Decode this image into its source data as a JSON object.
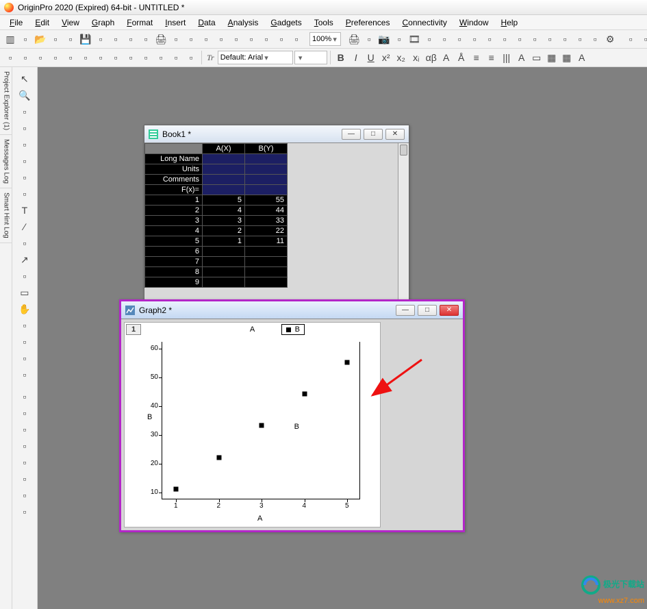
{
  "app": {
    "title": "OriginPro 2020 (Expired) 64-bit - UNTITLED *"
  },
  "menu": [
    "File",
    "Edit",
    "View",
    "Graph",
    "Format",
    "Insert",
    "Data",
    "Analysis",
    "Gadgets",
    "Tools",
    "Preferences",
    "Connectivity",
    "Window",
    "Help"
  ],
  "toolbar1": {
    "zoom": "100%",
    "icons": [
      "new-project",
      "new-folder",
      "open",
      "open-template",
      "open-excel",
      "save",
      "save-template",
      "import",
      "export",
      "new-layout",
      "print",
      "app",
      "refresh",
      "tile",
      "cascade",
      "duplicate",
      "close",
      "p1",
      "p2",
      "p3"
    ],
    "icons2": [
      "print",
      "print-preview",
      "camera",
      "slideshow",
      "film",
      "rescale",
      "axis",
      "legend",
      "marker",
      "addlayer",
      "merge",
      "extract",
      "d1",
      "d2",
      "d3",
      "d4",
      "batch",
      "gear"
    ],
    "icons3": [
      "p1",
      "p2",
      "p3",
      "p4",
      "p5",
      "p6",
      "p7",
      "p8",
      "p9",
      "p10",
      "p11"
    ]
  },
  "toolbar2": {
    "font": "Default: Arial",
    "size": "",
    "prefix_label": "Tr",
    "buttons": [
      "B",
      "I",
      "U",
      "x²",
      "x₂",
      "xᵢ",
      "αβ",
      "A",
      "Å",
      "≡",
      "≡",
      "|||",
      "A",
      "▭",
      "▦",
      "▦",
      "A"
    ]
  },
  "side_tabs": [
    "Project Explorer (1)",
    "Messages Log",
    "Smart Hint Log"
  ],
  "vtools": [
    "pointer",
    "zoom-in",
    "reader",
    "crosshair",
    "data-display",
    "mask",
    "pan2",
    "region",
    "text",
    "line",
    "open-arrow",
    "arrow",
    "line-tool",
    "rect",
    "hand",
    "scale",
    "draw",
    "bucket",
    "color",
    "palette1",
    "palette2",
    "palette3",
    "table",
    "star",
    "grid",
    "db",
    "worksheet"
  ],
  "book_win": {
    "title": "Book1 *",
    "col_headers": [
      "A(X)",
      "B(Y)"
    ],
    "row_labels": [
      "Long Name",
      "Units",
      "Comments",
      "F(x)="
    ],
    "rows_idx": [
      "1",
      "2",
      "3",
      "4",
      "5",
      "6",
      "7",
      "8",
      "9"
    ],
    "data": [
      [
        "5",
        "55"
      ],
      [
        "4",
        "44"
      ],
      [
        "3",
        "33"
      ],
      [
        "2",
        "22"
      ],
      [
        "1",
        "11"
      ],
      [
        "",
        ""
      ],
      [
        "",
        ""
      ],
      [
        "",
        ""
      ],
      [
        "",
        ""
      ]
    ]
  },
  "graph_win": {
    "title": "Graph2 *",
    "page_tab": "1",
    "top_title": "A",
    "legend": "B",
    "xlabel": "A",
    "ylabel": "B",
    "ylabel_right": "B"
  },
  "chart_data": {
    "type": "scatter",
    "x": [
      1,
      2,
      3,
      4,
      5
    ],
    "y": [
      11,
      22,
      33,
      44,
      55
    ],
    "series_name": "B",
    "title": "A",
    "xlabel": "A",
    "ylabel": "B",
    "xlim": [
      1,
      5
    ],
    "ylim": [
      10,
      60
    ],
    "xticks": [
      1,
      2,
      3,
      4,
      5
    ],
    "yticks": [
      10,
      20,
      30,
      40,
      50,
      60
    ],
    "right_ylabel": "B"
  },
  "win_btns": {
    "min": "—",
    "max": "□",
    "close": "✕"
  },
  "watermark": {
    "brand": "极光下载站",
    "url": "www.xz7.com"
  }
}
